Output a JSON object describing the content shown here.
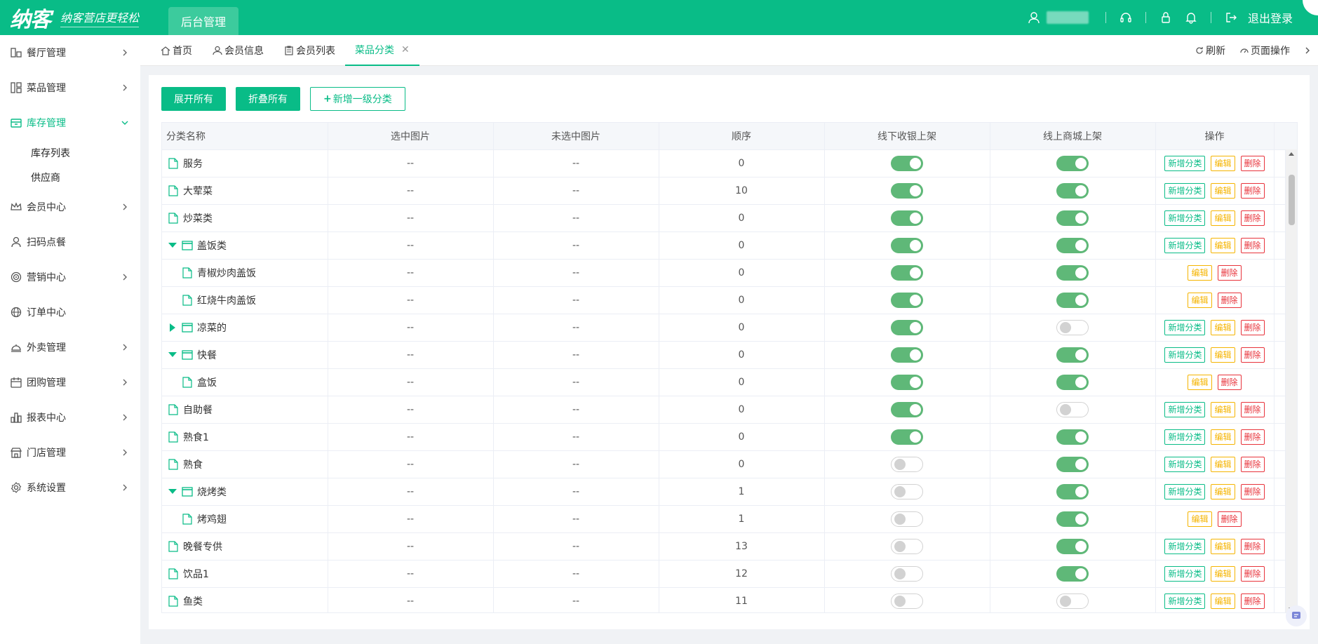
{
  "header": {
    "logo": "纳客",
    "slogan": "纳客营店更轻松",
    "active_tab": "后台管理",
    "logout": "退出登录"
  },
  "sidebar": {
    "items": [
      {
        "label": "餐厅管理",
        "icon": "restaurant-icon",
        "has_arrow": true
      },
      {
        "label": "菜品管理",
        "icon": "dishes-icon",
        "has_arrow": true
      },
      {
        "label": "库存管理",
        "icon": "inventory-icon",
        "has_arrow": true,
        "active": true,
        "children": [
          "库存列表",
          "供应商"
        ]
      },
      {
        "label": "会员中心",
        "icon": "crown-icon",
        "has_arrow": true
      },
      {
        "label": "扫码点餐",
        "icon": "user-icon",
        "has_arrow": false
      },
      {
        "label": "营销中心",
        "icon": "target-icon",
        "has_arrow": true
      },
      {
        "label": "订单中心",
        "icon": "globe-icon",
        "has_arrow": false
      },
      {
        "label": "外卖管理",
        "icon": "bell-dish-icon",
        "has_arrow": true
      },
      {
        "label": "团购管理",
        "icon": "calendar-icon",
        "has_arrow": true
      },
      {
        "label": "报表中心",
        "icon": "bar-chart-icon",
        "has_arrow": true
      },
      {
        "label": "门店管理",
        "icon": "store-icon",
        "has_arrow": true
      },
      {
        "label": "系统设置",
        "icon": "gear-icon",
        "has_arrow": true
      }
    ]
  },
  "tabs": [
    {
      "label": "首页",
      "icon": "home-icon"
    },
    {
      "label": "会员信息",
      "icon": "user-icon"
    },
    {
      "label": "会员列表",
      "icon": "clipboard-icon"
    },
    {
      "label": "菜品分类",
      "icon": "",
      "active": true,
      "closable": true
    }
  ],
  "tab_actions": {
    "refresh": "刷新",
    "page_ops": "页面操作"
  },
  "toolbar": {
    "expand_all": "展开所有",
    "collapse_all": "折叠所有",
    "add_top": "新增一级分类"
  },
  "table": {
    "headers": [
      "分类名称",
      "选中图片",
      "未选中图片",
      "顺序",
      "线下收银上架",
      "线上商城上架",
      "操作"
    ],
    "op_labels": {
      "add": "新增分类",
      "edit": "编辑",
      "del": "删除"
    },
    "rows": [
      {
        "name": "服务",
        "sel": "--",
        "unsel": "--",
        "order": "0",
        "offline": true,
        "online": true,
        "level": 0,
        "node": "leaf",
        "add": true
      },
      {
        "name": "大荤菜",
        "sel": "--",
        "unsel": "--",
        "order": "10",
        "offline": true,
        "online": true,
        "level": 0,
        "node": "leaf",
        "add": true
      },
      {
        "name": "炒菜类",
        "sel": "--",
        "unsel": "--",
        "order": "0",
        "offline": true,
        "online": true,
        "level": 0,
        "node": "leaf",
        "add": true
      },
      {
        "name": "盖饭类",
        "sel": "--",
        "unsel": "--",
        "order": "0",
        "offline": true,
        "online": true,
        "level": 0,
        "node": "expanded",
        "add": true
      },
      {
        "name": "青椒炒肉盖饭",
        "sel": "--",
        "unsel": "--",
        "order": "0",
        "offline": true,
        "online": true,
        "level": 1,
        "node": "leaf",
        "add": false
      },
      {
        "name": "红烧牛肉盖饭",
        "sel": "--",
        "unsel": "--",
        "order": "0",
        "offline": true,
        "online": true,
        "level": 1,
        "node": "leaf",
        "add": false
      },
      {
        "name": "凉菜的",
        "sel": "--",
        "unsel": "--",
        "order": "0",
        "offline": true,
        "online": false,
        "level": 0,
        "node": "collapsed",
        "add": true
      },
      {
        "name": "快餐",
        "sel": "--",
        "unsel": "--",
        "order": "0",
        "offline": true,
        "online": true,
        "level": 0,
        "node": "expanded",
        "add": true
      },
      {
        "name": "盒饭",
        "sel": "--",
        "unsel": "--",
        "order": "0",
        "offline": true,
        "online": true,
        "level": 1,
        "node": "leaf",
        "add": false
      },
      {
        "name": "自助餐",
        "sel": "--",
        "unsel": "--",
        "order": "0",
        "offline": true,
        "online": false,
        "level": 0,
        "node": "leaf",
        "add": true
      },
      {
        "name": "熟食1",
        "sel": "--",
        "unsel": "--",
        "order": "0",
        "offline": true,
        "online": true,
        "level": 0,
        "node": "leaf",
        "add": true
      },
      {
        "name": "熟食",
        "sel": "--",
        "unsel": "--",
        "order": "0",
        "offline": false,
        "online": true,
        "level": 0,
        "node": "leaf",
        "add": true
      },
      {
        "name": "烧烤类",
        "sel": "--",
        "unsel": "--",
        "order": "1",
        "offline": false,
        "online": true,
        "level": 0,
        "node": "expanded",
        "add": true
      },
      {
        "name": "烤鸡翅",
        "sel": "--",
        "unsel": "--",
        "order": "1",
        "offline": false,
        "online": true,
        "level": 1,
        "node": "leaf",
        "add": false
      },
      {
        "name": "晚餐专供",
        "sel": "--",
        "unsel": "--",
        "order": "13",
        "offline": false,
        "online": true,
        "level": 0,
        "node": "leaf",
        "add": true
      },
      {
        "name": "饮品1",
        "sel": "--",
        "unsel": "--",
        "order": "12",
        "offline": false,
        "online": true,
        "level": 0,
        "node": "leaf",
        "add": true
      },
      {
        "name": "鱼类",
        "sel": "--",
        "unsel": "--",
        "order": "11",
        "offline": false,
        "online": false,
        "level": 0,
        "node": "leaf",
        "add": true
      }
    ]
  },
  "colors": {
    "brand": "#09bc87",
    "toggle_on": "#5fb878",
    "edit": "#f5b400",
    "delete": "#e8333b"
  }
}
